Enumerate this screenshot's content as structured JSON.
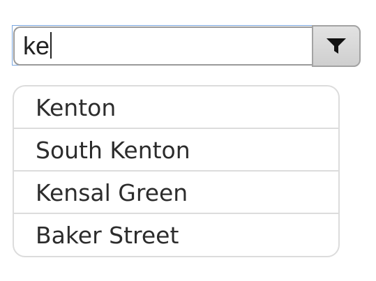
{
  "search": {
    "value": "ke",
    "filter_icon": "filter-funnel-icon"
  },
  "results": {
    "items": [
      {
        "label": "Kenton"
      },
      {
        "label": "South Kenton"
      },
      {
        "label": "Kensal Green"
      },
      {
        "label": "Baker Street"
      }
    ]
  },
  "colors": {
    "input_border": "#9a9a9a",
    "focus_ring": "#7aa7e0",
    "button_bg": "#d9d9d9",
    "list_border": "#dcdcdc",
    "text": "#2c2c2c"
  }
}
